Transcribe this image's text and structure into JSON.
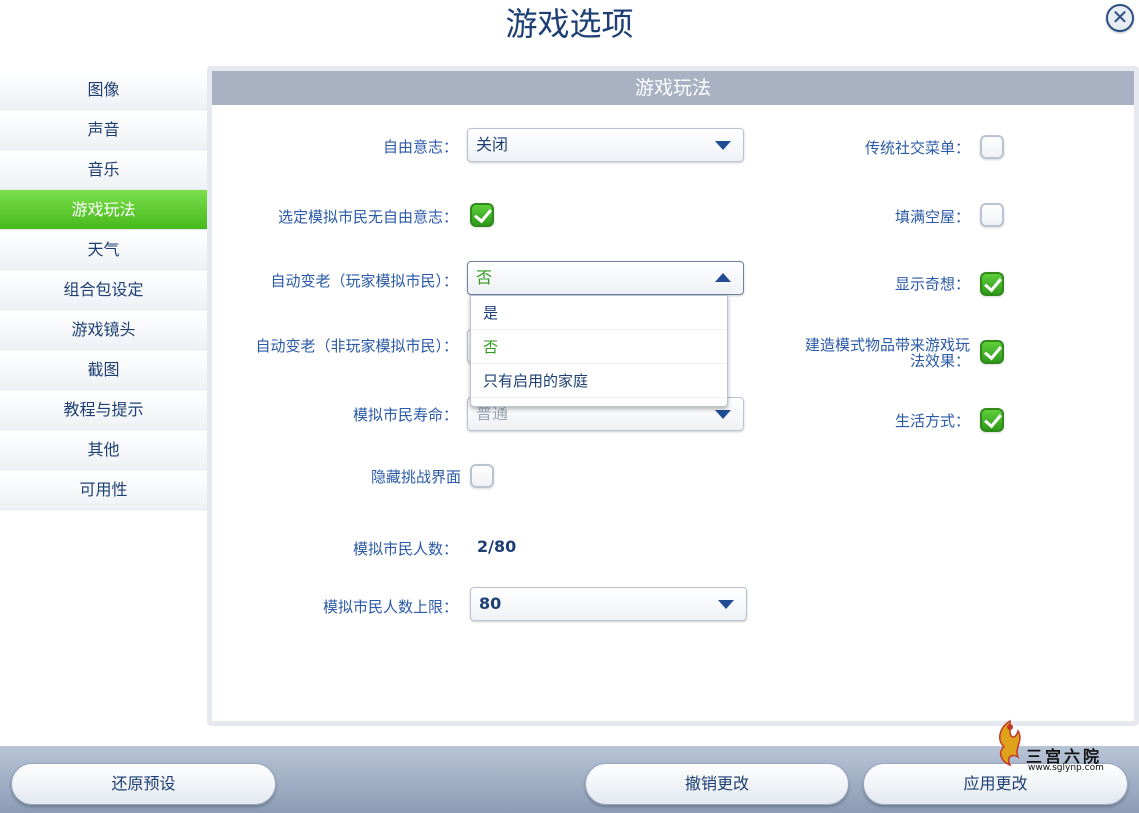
{
  "window": {
    "title": "游戏选项",
    "close_glyph": "✕"
  },
  "sidebar": {
    "items": [
      {
        "label": "图像"
      },
      {
        "label": "声音"
      },
      {
        "label": "音乐"
      },
      {
        "label": "游戏玩法",
        "active": true
      },
      {
        "label": "天气"
      },
      {
        "label": "组合包设定"
      },
      {
        "label": "游戏镜头"
      },
      {
        "label": "截图"
      },
      {
        "label": "教程与提示"
      },
      {
        "label": "其他"
      },
      {
        "label": "可用性"
      }
    ]
  },
  "panel": {
    "header": "游戏玩法",
    "left": {
      "free_will": {
        "label": "自由意志：",
        "value": "关闭"
      },
      "selected_sim_no_free_will": {
        "label": "选定模拟市民无自由意志：",
        "checked": true
      },
      "auto_age_played": {
        "label": "自动变老（玩家模拟市民）：",
        "value": "否",
        "open": true
      },
      "auto_age_unplayed": {
        "label": "自动变老（非玩家模拟市民）："
      },
      "sim_lifespan": {
        "label": "模拟市民寿命：",
        "value": "普通"
      },
      "hide_challenge_ui": {
        "label": "隐藏挑战界面",
        "checked": false
      },
      "sim_count": {
        "label": "模拟市民人数：",
        "value": "2/80"
      },
      "sim_limit": {
        "label": "模拟市民人数上限：",
        "value": "80"
      }
    },
    "dropdown_options": [
      {
        "label": "是"
      },
      {
        "label": "否",
        "selected": true
      },
      {
        "label": "只有启用的家庭"
      }
    ],
    "right": {
      "legacy_social_menu": {
        "label": "传统社交菜单：",
        "checked": false
      },
      "fill_empty_houses": {
        "label": "填满空屋：",
        "checked": false
      },
      "show_whims": {
        "label": "显示奇想：",
        "checked": true
      },
      "build_mode_effects": {
        "label_line1": "建造模式物品带来游戏玩",
        "label_line2": "法效果：",
        "checked": true
      },
      "lifestyles": {
        "label": "生活方式：",
        "checked": true
      }
    }
  },
  "bottom": {
    "restore_defaults": "还原预设",
    "undo_changes": "撤销更改",
    "apply_changes": "应用更改"
  },
  "watermark": {
    "text": "三宫六院",
    "url": "www.sglynp.com"
  }
}
